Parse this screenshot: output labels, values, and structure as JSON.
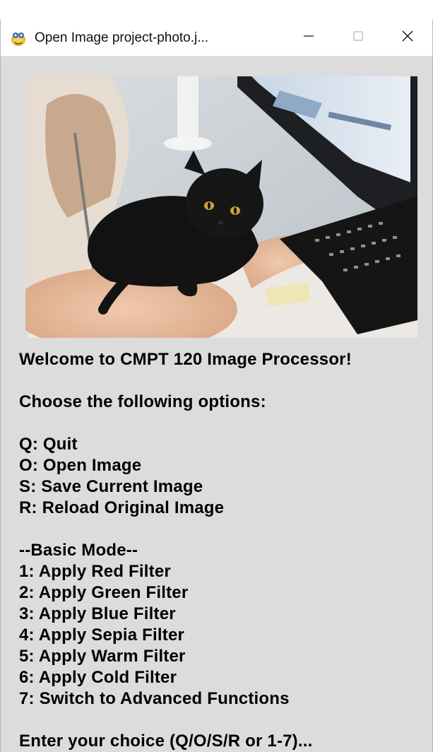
{
  "window": {
    "title": "Open Image project-photo.j...",
    "controls": {
      "minimize": "—",
      "maximize": "☐",
      "close": "✕"
    }
  },
  "image": {
    "subject": "black cat lying next to a person typing on a keyboard in front of a computer monitor"
  },
  "menu": {
    "welcome": "Welcome to CMPT 120 Image Processor!",
    "choose": "Choose the following options:",
    "general_options": [
      "Q: Quit",
      "O: Open Image",
      "S: Save Current Image",
      "R: Reload Original Image"
    ],
    "mode_header": "--Basic Mode--",
    "mode_options": [
      "1: Apply Red Filter",
      "2: Apply Green Filter",
      "3: Apply Blue Filter",
      "4: Apply Sepia Filter",
      "5: Apply Warm Filter",
      "6: Apply Cold Filter",
      "7: Switch to Advanced Functions"
    ],
    "prompt": "Enter your choice (Q/O/S/R or 1-7)..."
  }
}
